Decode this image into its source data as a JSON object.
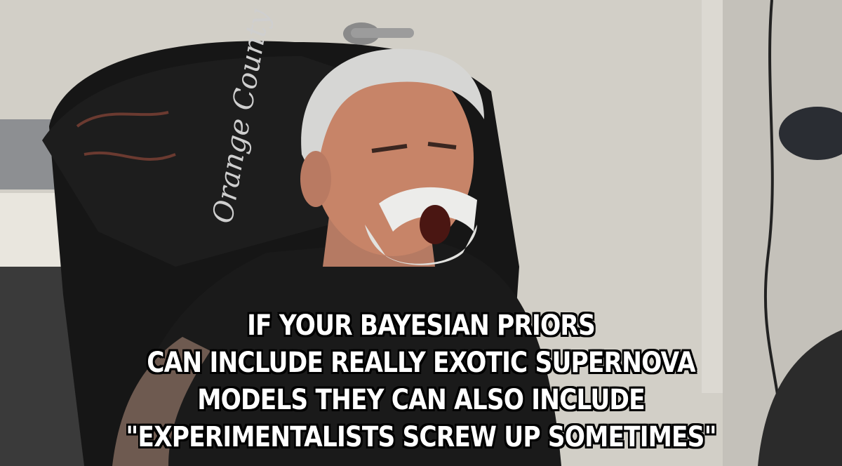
{
  "meme": {
    "caption_lines": [
      "IF YOUR BAYESIAN PRIORS",
      "CAN INCLUDE REALLY EXOTIC SUPERNOVA",
      "MODELS THEY CAN ALSO INCLUDE",
      "\"EXPERIMENTALISTS SCREW UP SOMETIMES\""
    ],
    "shirt_text": "Orange County"
  },
  "colors": {
    "wall": "#d4d1c9",
    "jacket": "#141414",
    "skin": "#c9876d",
    "hair": "#d8d8d8",
    "caption_text": "#ffffff",
    "caption_outline": "#000000"
  }
}
